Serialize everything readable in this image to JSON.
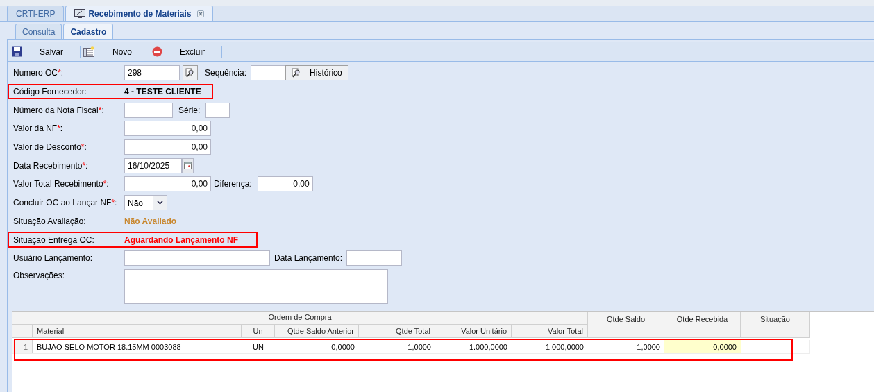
{
  "main_tabs": [
    {
      "label": "CRTI-ERP",
      "selected": false,
      "icon": false,
      "closable": false
    },
    {
      "label": "Recebimento de Materiais",
      "selected": true,
      "icon": true,
      "closable": true
    }
  ],
  "sub_tabs": [
    {
      "label": "Consulta",
      "selected": false
    },
    {
      "label": "Cadastro",
      "selected": true
    }
  ],
  "toolbar": [
    {
      "kind": "save",
      "label": "Salvar"
    },
    {
      "kind": "new",
      "label": "Novo"
    },
    {
      "kind": "delete",
      "label": "Excluir"
    }
  ],
  "form": [
    {
      "kind": "oc",
      "label": "Numero OC",
      "asterisk": "*",
      "colon": ":",
      "highlighted": false,
      "value": "298",
      "seq_label": "Sequência:",
      "history_label": "Histórico"
    },
    {
      "kind": "display",
      "label": "Código Fornecedor:",
      "highlighted": true,
      "value": "4 - TESTE CLIENTE"
    },
    {
      "kind": "nota",
      "label": "Número da Nota Fiscal",
      "asterisk": "*",
      "colon": ":",
      "highlighted": false,
      "serie_label": "Série:"
    },
    {
      "kind": "number",
      "label": "Valor da NF",
      "asterisk": "*",
      "colon": ":",
      "highlighted": false,
      "value": "0,00"
    },
    {
      "kind": "number",
      "label": "Valor de Desconto",
      "asterisk": "*",
      "colon": ":",
      "highlighted": false,
      "value": "0,00"
    },
    {
      "kind": "date",
      "label": "Data Recebimento",
      "asterisk": "*",
      "colon": ":",
      "highlighted": false,
      "value": "16/10/2025"
    },
    {
      "kind": "total",
      "label": "Valor Total Recebimento",
      "asterisk": "*",
      "colon": ":",
      "highlighted": false,
      "value": "0,00",
      "diff_label": "Diferença:",
      "diff_value": "0,00"
    },
    {
      "kind": "select",
      "label": "Concluir OC ao Lançar NF",
      "asterisk": "*",
      "colon": ":",
      "highlighted": false,
      "value": "Não"
    },
    {
      "kind": "status",
      "label": "Situação Avaliação:",
      "highlighted": false,
      "value": "Não Avaliado",
      "color": "#c8872f"
    },
    {
      "kind": "status",
      "label": "Situação Entrega OC:",
      "highlighted": true,
      "value": "Aguardando Lançamento NF",
      "color": "#ff0000"
    },
    {
      "kind": "usuario",
      "label": "Usuário Lançamento:",
      "highlighted": false,
      "data_label": "Data Lançamento:"
    },
    {
      "kind": "textarea",
      "label": "Observações:",
      "highlighted": false
    }
  ],
  "grid": {
    "group_header": "Ordem de Compra",
    "columns": [
      "Material",
      "Un",
      "Qtde Saldo Anterior",
      "Qtde Total",
      "Valor Unitário",
      "Valor Total"
    ],
    "side_columns": [
      "Qtde Saldo",
      "Qtde Recebida",
      "Situação"
    ],
    "rows": [
      {
        "number": "1",
        "highlighted": true,
        "cells": [
          "BUJAO SELO MOTOR 18.15MM 0003088",
          "UN",
          "0,0000",
          "1,0000",
          "1.000,0000",
          "1.000,0000",
          "1,0000",
          "0,0000"
        ]
      }
    ]
  }
}
